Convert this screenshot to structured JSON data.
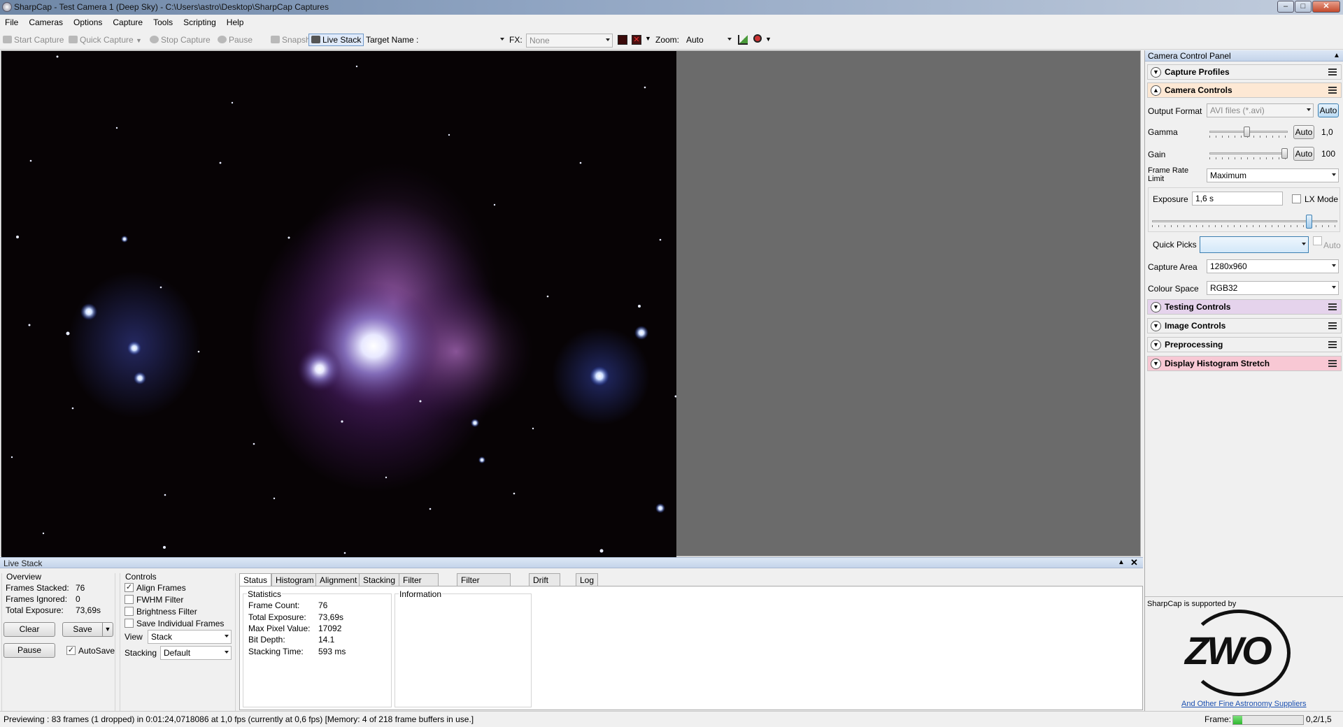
{
  "window": {
    "title": "SharpCap - Test Camera 1 (Deep Sky) - C:\\Users\\astro\\Desktop\\SharpCap Captures"
  },
  "menu": [
    "File",
    "Cameras",
    "Options",
    "Capture",
    "Tools",
    "Scripting",
    "Help"
  ],
  "toolbar": {
    "start_capture": "Start Capture",
    "quick_capture": "Quick Capture",
    "stop_capture": "Stop Capture",
    "pause": "Pause",
    "snapshot": "Snapshot",
    "live_stack": "Live Stack",
    "target_name_label": "Target Name :",
    "target_name_value": "",
    "fx_label": "FX:",
    "fx_value": "None",
    "zoom_label": "Zoom:",
    "zoom_value": "Auto"
  },
  "camera_panel": {
    "title": "Camera Control Panel",
    "sections": {
      "capture_profiles": "Capture Profiles",
      "camera_controls": "Camera Controls",
      "testing_controls": "Testing Controls",
      "image_controls": "Image Controls",
      "preprocessing": "Preprocessing",
      "display_histogram_stretch": "Display Histogram Stretch"
    },
    "section_colors": {
      "camera_controls": "#fde8d4",
      "testing_controls": "#e5d3ec",
      "display_histogram_stretch": "#f8c8d4"
    },
    "output_format_label": "Output Format",
    "output_format_value": "AVI files (*.avi)",
    "auto_label": "Auto",
    "gamma_label": "Gamma",
    "gamma_value": "1,0",
    "gamma_level": 0.48,
    "gain_label": "Gain",
    "gain_value": "100",
    "gain_level": 1.0,
    "frame_rate_label": "Frame Rate Limit",
    "frame_rate_value": "Maximum",
    "exposure_label": "Exposure",
    "exposure_value": "1,6 s",
    "exposure_level": 0.86,
    "lx_mode_label": "LX Mode",
    "quick_picks_label": "Quick Picks",
    "quick_picks_value": "",
    "quick_picks_auto": "Auto",
    "capture_area_label": "Capture Area",
    "capture_area_value": "1280x960",
    "colour_space_label": "Colour Space",
    "colour_space_value": "RGB32"
  },
  "sponsor": {
    "supported_by": "SharpCap is supported by",
    "logo_text": "ZWO",
    "link": "And Other Fine Astronomy Suppliers"
  },
  "live_stack": {
    "title": "Live Stack",
    "overview_label": "Overview",
    "frames_stacked_label": "Frames Stacked:",
    "frames_stacked_value": "76",
    "frames_ignored_label": "Frames Ignored:",
    "frames_ignored_value": "0",
    "total_exposure_label": "Total Exposure:",
    "total_exposure_value": "73,69s",
    "clear": "Clear",
    "save": "Save",
    "pause": "Pause",
    "autosave": "AutoSave",
    "controls_label": "Controls",
    "align_frames": "Align Frames",
    "fwhm_filter": "FWHM Filter",
    "brightness_filter": "Brightness Filter",
    "save_individual_frames": "Save Individual Frames",
    "view_label": "View",
    "view_value": "Stack",
    "stacking_label": "Stacking",
    "stacking_value": "Default",
    "tabs": [
      "Status",
      "Histogram",
      "Alignment",
      "Stacking",
      "Filter (FWHM)",
      "Filter (Brightness)",
      "Drift Graph",
      "Log"
    ],
    "statistics_label": "Statistics",
    "stats": [
      {
        "label": "Frame Count:",
        "value": "76"
      },
      {
        "label": "Total Exposure:",
        "value": "73,69s"
      },
      {
        "label": "Max Pixel Value:",
        "value": "17092"
      },
      {
        "label": "Bit Depth:",
        "value": "14.1"
      },
      {
        "label": "Stacking Time:",
        "value": "593 ms"
      }
    ],
    "information_label": "Information"
  },
  "status_bar": {
    "text": "Previewing : 83 frames (1 dropped) in 0:01:24,0718086 at 1,0 fps  (currently at 0,6 fps) [Memory: 4 of 218 frame buffers in use.]",
    "frame_label": "Frame:",
    "frame_value": "0,2/1,5",
    "frame_progress": 0.13
  }
}
